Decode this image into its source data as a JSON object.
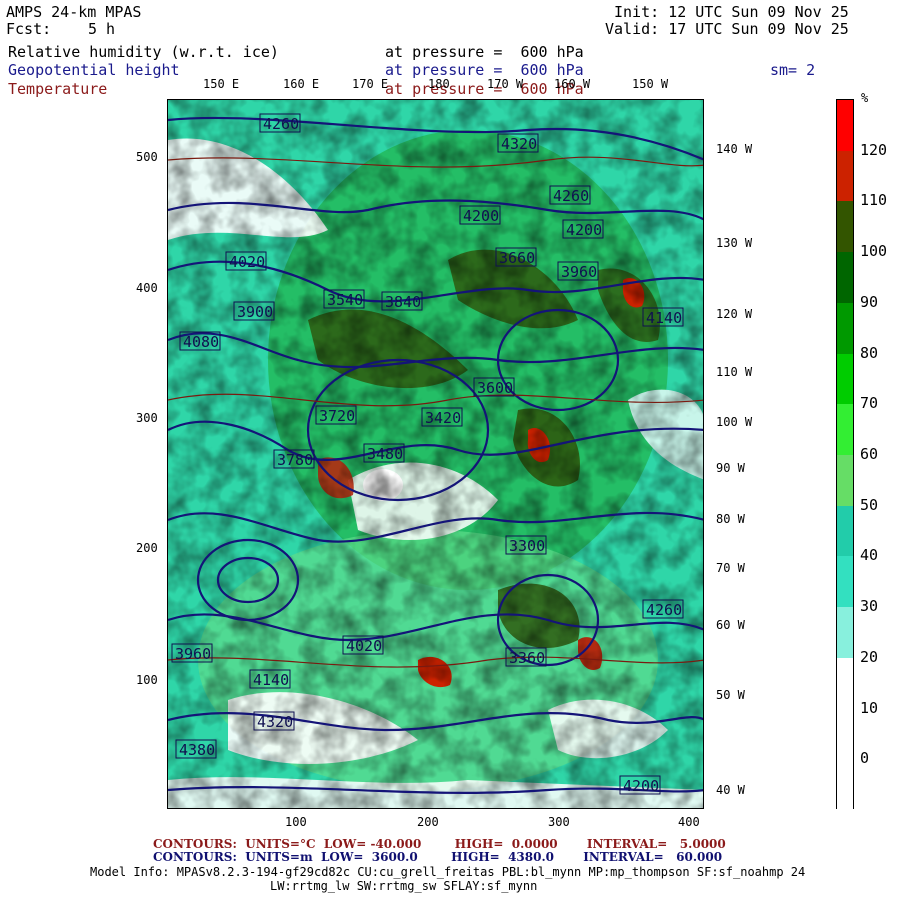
{
  "header": {
    "model": "AMPS 24-km MPAS",
    "fcst_label": "Fcst:",
    "fcst_value": "5 h",
    "init": "Init: 12 UTC Sun 09 Nov 25",
    "valid": "Valid: 17 UTC Sun 09 Nov 25"
  },
  "fields": [
    {
      "name": "Relative humidity (w.r.t. ice)",
      "level": "at pressure =  600 hPa",
      "color": "#000000"
    },
    {
      "name": "Geopotential height",
      "level": "at pressure =  600 hPa",
      "color": "#1a1a8c"
    },
    {
      "name": "Temperature",
      "level": "at pressure =  600 hPa",
      "color": "#8b1a1a"
    }
  ],
  "smoothing": "sm= 2",
  "top_lon_labels": [
    "150 E",
    "160 E",
    "170 E",
    "180",
    "170 W",
    "160 W",
    "150 W"
  ],
  "right_lon_labels": [
    "140 W",
    "130 W",
    "120 W",
    "110 W",
    "100 W",
    "90 W",
    "80 W",
    "70 W",
    "60 W",
    "50 W",
    "40 W"
  ],
  "y_ticks": [
    "500",
    "400",
    "300",
    "200",
    "100"
  ],
  "x_ticks": [
    "100",
    "200",
    "300",
    "400"
  ],
  "height_labels": [
    "4260",
    "4320",
    "4200",
    "4260",
    "4200",
    "4140",
    "4080",
    "3960",
    "4020",
    "3900",
    "3840",
    "3780",
    "3720",
    "3660",
    "3600",
    "3540",
    "3480",
    "3420",
    "3360",
    "3300",
    "3960",
    "4020",
    "4140",
    "4200",
    "4260",
    "4320",
    "4380"
  ],
  "colorbar": {
    "unit": "%",
    "labels": [
      "120",
      "110",
      "100",
      "90",
      "80",
      "70",
      "60",
      "50",
      "40",
      "30",
      "20",
      "10",
      "0"
    ],
    "colors": [
      "#ff0000",
      "#cc2200",
      "#335500",
      "#006600",
      "#009900",
      "#00cc00",
      "#33ee33",
      "#66dd66",
      "#22ccaa",
      "#33e0c0",
      "#88f0dd",
      "#ffffff",
      "#ffffff",
      "#ffffff"
    ]
  },
  "footer": {
    "temp_contours": "CONTOURS:  UNITS=°C  LOW= -40.000        HIGH=  0.0000       INTERVAL=   5.0000",
    "height_contours": "CONTOURS:  UNITS=m  LOW=  3600.0        HIGH=  4380.0       INTERVAL=   60.000",
    "model_info": "Model Info: MPASv8.2.3-194-gf29cd82c CU:cu_grell_freitas PBL:bl_mynn MP:mp_thompson SF:sf_noahmp 24",
    "model_info2": "LW:rrtmg_lw SW:rrtmg_sw SFLAY:sf_mynn"
  }
}
